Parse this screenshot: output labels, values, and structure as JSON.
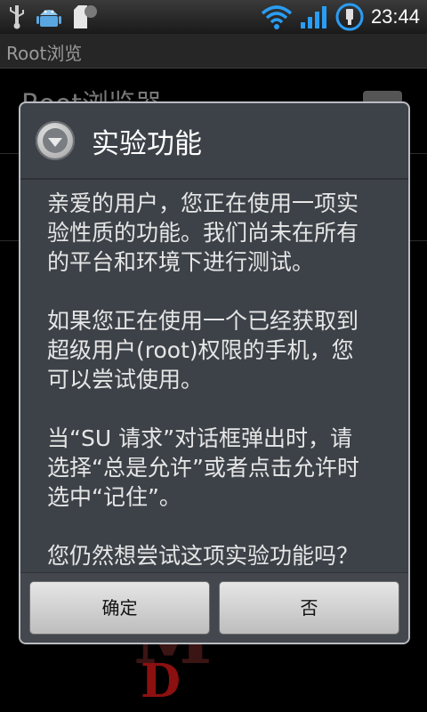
{
  "status_bar": {
    "time": "23:44",
    "left_icons": [
      "usb-icon",
      "android-icon",
      "sd-card-icon"
    ],
    "right_icons": [
      "wifi-icon",
      "signal-icon",
      "battery-charging-icon"
    ]
  },
  "title_bar": {
    "title": "Root浏览"
  },
  "background": {
    "heading": "Root浏览器"
  },
  "dialog": {
    "icon": "alert-icon",
    "title": "实验功能",
    "paragraphs": [
      "亲爱的用户，您正在使用一项实\n验性质的功能。我们尚未在所有\n的平台和环境下进行测试。",
      "如果您正在使用一个已经获取到\n超级用户(root)权限的手机，您\n可以尝试使用。",
      "当“SU 请求”对话框弹出时，请\n选择“总是允许”或者点击允许时\n选中“记住”。",
      "您仍然想尝试这项实验功能吗？"
    ],
    "buttons": {
      "ok": "确定",
      "no": "否"
    }
  },
  "colors": {
    "dialog_bg": "#3d4248",
    "dialog_border": "#b9bcc0",
    "button_bg": "#d6d6d6",
    "wifi_accent": "#2a9df4"
  }
}
